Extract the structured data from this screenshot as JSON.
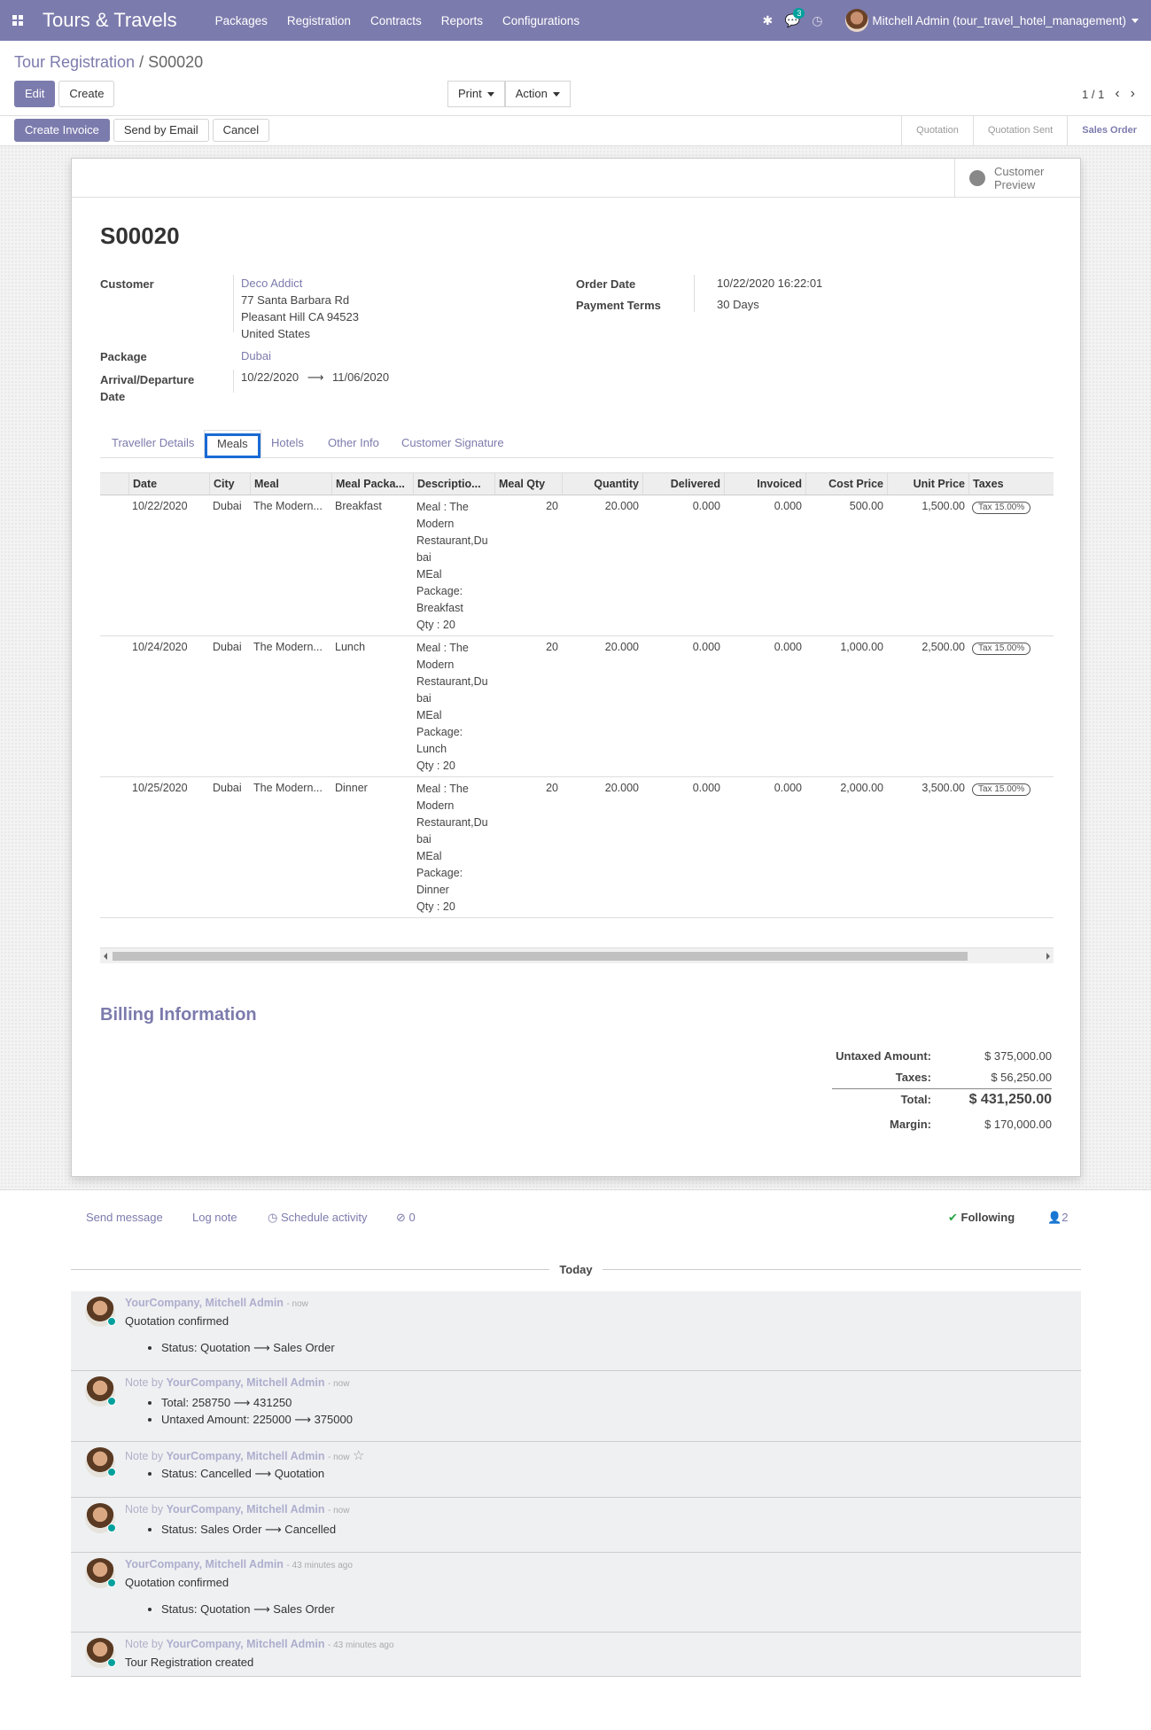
{
  "navbar": {
    "brand": "Tours & Travels",
    "menu": [
      "Packages",
      "Registration",
      "Contracts",
      "Reports",
      "Configurations"
    ],
    "messages_badge": "3",
    "user": "Mitchell Admin (tour_travel_hotel_management)"
  },
  "breadcrumb": {
    "parent": "Tour Registration",
    "sep": "/",
    "current": "S00020"
  },
  "buttons": {
    "edit": "Edit",
    "create": "Create",
    "print": "Print",
    "action": "Action",
    "pager": "1 / 1"
  },
  "status_buttons": {
    "create_invoice": "Create Invoice",
    "send_email": "Send by Email",
    "cancel": "Cancel"
  },
  "stages": [
    "Quotation",
    "Quotation Sent",
    "Sales Order"
  ],
  "sheet": {
    "preview_label_1": "Customer",
    "preview_label_2": "Preview",
    "title": "S00020",
    "customer_label": "Customer",
    "customer_name": "Deco Addict",
    "address_1": "77 Santa Barbara Rd",
    "address_2": "Pleasant Hill CA 94523",
    "address_3": "United States",
    "package_label": "Package",
    "package": "Dubai",
    "arrival_label_1": "Arrival/Departure",
    "arrival_label_2": "Date",
    "arrival": "10/22/2020",
    "departure": "11/06/2020",
    "order_date_label": "Order Date",
    "order_date": "10/22/2020 16:22:01",
    "payment_terms_label": "Payment Terms",
    "payment_terms": "30 Days"
  },
  "tabs": [
    "Traveller Details",
    "Meals",
    "Hotels",
    "Other Info",
    "Customer Signature"
  ],
  "table": {
    "headers": [
      "Date",
      "City",
      "Meal",
      "Meal Packa...",
      "Descriptio...",
      "Meal Qty",
      "Quantity",
      "Delivered",
      "Invoiced",
      "Cost Price",
      "Unit Price",
      "Taxes"
    ],
    "rows": [
      {
        "date": "10/22/2020",
        "city": "Dubai",
        "meal": "The Modern...",
        "package": "Breakfast",
        "desc_lines": [
          "Meal : The",
          "Modern",
          "Restaurant,Du",
          "bai",
          "MEal",
          "Package:",
          "Breakfast",
          "Qty : 20"
        ],
        "meal_qty": "20",
        "quantity": "20.000",
        "delivered": "0.000",
        "invoiced": "0.000",
        "cost": "500.00",
        "unit": "1,500.00",
        "tax": "Tax 15.00%"
      },
      {
        "date": "10/24/2020",
        "city": "Dubai",
        "meal": "The Modern...",
        "package": "Lunch",
        "desc_lines": [
          "Meal : The",
          "Modern",
          "Restaurant,Du",
          "bai",
          "MEal",
          "Package:",
          "Lunch",
          "Qty : 20"
        ],
        "meal_qty": "20",
        "quantity": "20.000",
        "delivered": "0.000",
        "invoiced": "0.000",
        "cost": "1,000.00",
        "unit": "2,500.00",
        "tax": "Tax 15.00%"
      },
      {
        "date": "10/25/2020",
        "city": "Dubai",
        "meal": "The Modern...",
        "package": "Dinner",
        "desc_lines": [
          "Meal : The",
          "Modern",
          "Restaurant,Du",
          "bai",
          "MEal",
          "Package:",
          "Dinner",
          "Qty : 20"
        ],
        "meal_qty": "20",
        "quantity": "20.000",
        "delivered": "0.000",
        "invoiced": "0.000",
        "cost": "2,000.00",
        "unit": "3,500.00",
        "tax": "Tax 15.00%"
      }
    ]
  },
  "billing": {
    "title": "Billing Information",
    "untaxed_label": "Untaxed Amount:",
    "untaxed": "$ 375,000.00",
    "taxes_label": "Taxes:",
    "taxes": "$ 56,250.00",
    "total_label": "Total:",
    "total": "$ 431,250.00",
    "margin_label": "Margin:",
    "margin": "$ 170,000.00"
  },
  "chatter": {
    "send_message": "Send message",
    "log_note": "Log note",
    "schedule": "Schedule activity",
    "attachments": "0",
    "following": "Following",
    "followers": "2",
    "today": "Today",
    "messages": [
      {
        "prefix": "",
        "author": "YourCompany, Mitchell Admin",
        "time": "- now",
        "text": "Quotation confirmed",
        "items": [
          "Status: Quotation ⟶ Sales Order"
        ]
      },
      {
        "prefix": "Note by",
        "author": "YourCompany, Mitchell Admin",
        "time": "- now",
        "text": "",
        "items": [
          "Total: 258750 ⟶ 431250",
          "Untaxed Amount: 225000 ⟶ 375000"
        ]
      },
      {
        "prefix": "Note by",
        "author": "YourCompany, Mitchell Admin",
        "time": "- now",
        "text": "",
        "items": [
          "Status: Cancelled ⟶ Quotation"
        ]
      },
      {
        "prefix": "Note by",
        "author": "YourCompany, Mitchell Admin",
        "time": "- now",
        "text": "",
        "items": [
          "Status: Sales Order ⟶ Cancelled"
        ]
      },
      {
        "prefix": "",
        "author": "YourCompany, Mitchell Admin",
        "time": "- 43 minutes ago",
        "text": "Quotation confirmed",
        "items": [
          "Status: Quotation ⟶ Sales Order"
        ]
      },
      {
        "prefix": "Note by",
        "author": "YourCompany, Mitchell Admin",
        "time": "- 43 minutes ago",
        "text": "Tour Registration created",
        "items": []
      }
    ]
  }
}
